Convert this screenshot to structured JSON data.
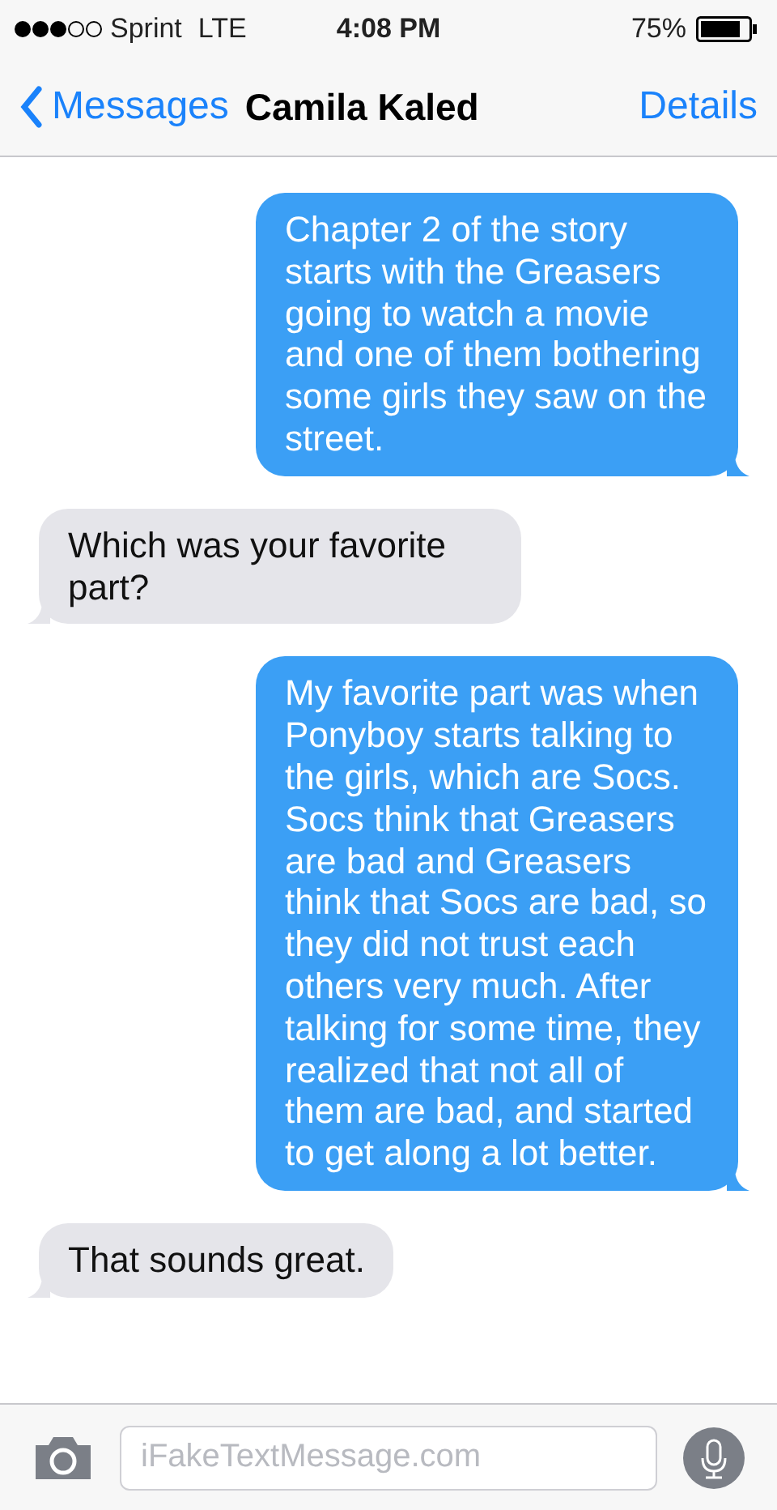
{
  "status_bar": {
    "carrier": "Sprint",
    "network": "LTE",
    "time": "4:08 PM",
    "battery": "75%"
  },
  "nav": {
    "back": "Messages",
    "title": "Camila Kaled",
    "action": "Details"
  },
  "messages": [
    {
      "kind": "sent",
      "text": "Chapter 2 of the story starts with the Greasers going to watch a movie and one of them bothering some girls they saw on the street."
    },
    {
      "kind": "received",
      "text": "Which was your favorite part?"
    },
    {
      "kind": "sent",
      "text": "My favorite part was when Ponyboy starts talking to the girls, which are Socs. Socs think that Greasers are bad and Greasers think that Socs are bad, so they did not trust each others very much. After talking for some time, they realized that not all of them are bad, and started to get along a lot better."
    },
    {
      "kind": "received",
      "text": "That sounds great."
    }
  ],
  "composer": {
    "placeholder": "iFakeTextMessage.com"
  }
}
